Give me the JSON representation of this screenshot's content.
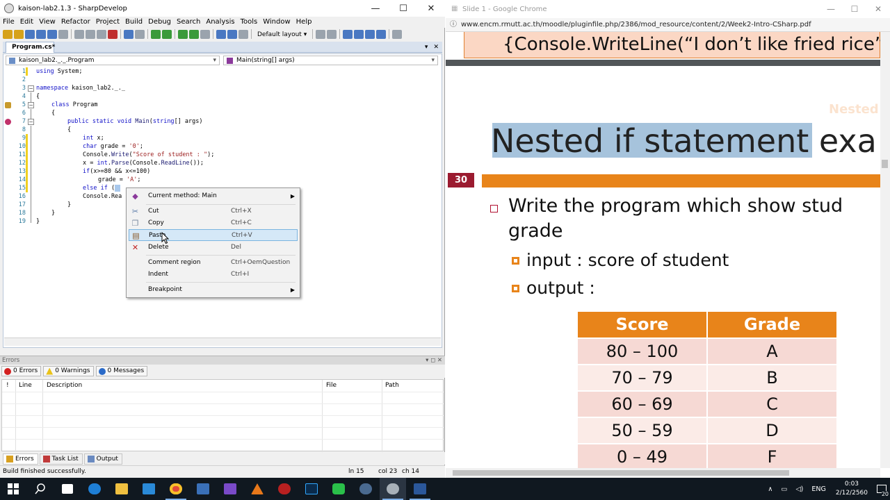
{
  "sharpdevelop": {
    "title": "kaison-lab2.1.3 - SharpDevelop",
    "window_buttons": {
      "minimize": "—",
      "maximize": "☐",
      "close": "✕"
    },
    "menu": [
      "File",
      "Edit",
      "View",
      "Refactor",
      "Project",
      "Build",
      "Debug",
      "Search",
      "Analysis",
      "Tools",
      "Window",
      "Help"
    ],
    "layout_dropdown": "Default layout",
    "document_tab": "Program.cs*",
    "doc_controls": {
      "dropdown": "▾",
      "close": "✕"
    },
    "class_combo": "kaison_lab2._._.Program",
    "member_combo": "Main(string[] args)",
    "line_numbers": [
      "1",
      "2",
      "3",
      "4",
      "5",
      "6",
      "7",
      "8",
      "9",
      "10",
      "11",
      "12",
      "13",
      "14",
      "15",
      "16",
      "17",
      "18",
      "19"
    ],
    "code": {
      "l1_kw": "using",
      "l1_rest": " System;",
      "l3_kw": "namespace",
      "l3_rest": " kaison_lab2._._",
      "l4": "{",
      "l5_kw": "class",
      "l5_rest": " Program",
      "l6": "{",
      "l7_kw1": "public static void",
      "l7_m": " Main",
      "l7_rest1": "(",
      "l7_kw2": "string",
      "l7_rest2": "[] args)",
      "l8": "{",
      "l9_kw": "int",
      "l9_rest": " x;",
      "l10_kw": "char",
      "l10_rest": " grade = ",
      "l10_str": "'0'",
      "l10_end": ";",
      "l11_a": "Console.",
      "l11_m": "Write",
      "l11_b": "(",
      "l11_str": "\"Score of student : \"",
      "l11_c": ");",
      "l12_a": "x = ",
      "l12_kw": "int",
      "l12_b": ".",
      "l12_m": "Parse",
      "l12_c": "(Console.",
      "l12_m2": "ReadLine",
      "l12_d": "());",
      "l13_kw": "if",
      "l13_rest": "(x>=80 && x<=100)",
      "l14_a": "grade = ",
      "l14_str": "'A'",
      "l14_b": ";",
      "l15_kw": "else if",
      "l15_rest": " (",
      "l16_a": "Console.Rea",
      "l17": "}",
      "l18": "}",
      "l19": "}"
    },
    "context_menu": {
      "items": [
        {
          "label": "Current method: Main",
          "shortcut": "",
          "icon": "method-icon"
        },
        {
          "label": "Cut",
          "shortcut": "Ctrl+X",
          "icon": "cut-icon"
        },
        {
          "label": "Copy",
          "shortcut": "Ctrl+C",
          "icon": "copy-icon"
        },
        {
          "label": "Paste",
          "shortcut": "Ctrl+V",
          "icon": "paste-icon"
        },
        {
          "label": "Delete",
          "shortcut": "Del",
          "icon": "delete-icon"
        },
        {
          "label": "Comment region",
          "shortcut": "Ctrl+OemQuestion",
          "icon": ""
        },
        {
          "label": "Indent",
          "shortcut": "Ctrl+I",
          "icon": ""
        },
        {
          "label": "Breakpoint",
          "shortcut": "",
          "icon": ""
        }
      ],
      "highlighted": "Paste"
    },
    "errors_pane": {
      "title": "Errors",
      "title_controls": "▾ ◻ ✕",
      "filters": {
        "errors": "0 Errors",
        "warnings": "0 Warnings",
        "messages": "0 Messages"
      },
      "columns": {
        "bang": "!",
        "line": "Line",
        "description": "Description",
        "file": "File",
        "path": "Path"
      }
    },
    "bottom_tabs": [
      "Errors",
      "Task List",
      "Output"
    ],
    "status": {
      "message": "Build finished successfully.",
      "line": "ln 15",
      "col": "col 23",
      "ch": "ch 14"
    }
  },
  "chrome": {
    "title": "Slide 1 - Google Chrome",
    "window_buttons": {
      "minimize": "—",
      "maximize": "☐",
      "close": "✕"
    },
    "url": "www.encm.rmutt.ac.th/moodle/pluginfile.php/2386/mod_resource/content/2/Week2-Intro-CSharp.pdf",
    "pdf": {
      "prev_page_text": "{Console.WriteLine(“I don’t like fried rice”",
      "faint_heading": "Nested",
      "slide_title": "Nested if statement exa",
      "slide_number": "30",
      "bullet_main_line1": "Write the program which show stud",
      "bullet_main_line2": "grade",
      "bullet_input": "input : score of student",
      "bullet_output": "output :",
      "table": {
        "headers": [
          "Score",
          "Grade"
        ],
        "rows": [
          [
            "80 – 100",
            "A"
          ],
          [
            "70 – 79",
            "B"
          ],
          [
            "60 – 69",
            "C"
          ],
          [
            "50 – 59",
            "D"
          ],
          [
            "0 – 49",
            "F"
          ]
        ]
      }
    },
    "colors": {
      "orange": "#e8841a",
      "crimson": "#9b1b30",
      "highlight": "#a6c3dc",
      "row_odd": "#f6d9d4",
      "row_even": "#fbebe7"
    }
  },
  "taskbar": {
    "apps": [
      "start-icon",
      "search-icon",
      "task-view-icon",
      "edge-icon",
      "file-explorer-icon",
      "store-icon",
      "chrome-icon",
      "media-icon",
      "visual-studio-icon",
      "vlc-icon",
      "game-icon",
      "photoshop-icon",
      "line-icon",
      "steam-icon",
      "sharpdevelop-icon",
      "word-icon"
    ],
    "language": "ENG",
    "time": "0:03",
    "date": "2/12/2560",
    "notification_count": "20"
  }
}
